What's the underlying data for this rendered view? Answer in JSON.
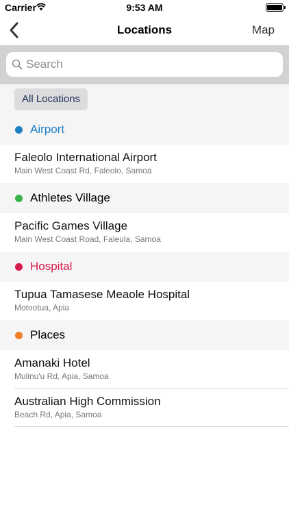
{
  "status_bar": {
    "carrier": "Carrier",
    "time": "9:53 AM"
  },
  "nav": {
    "title": "Locations",
    "map_label": "Map"
  },
  "search": {
    "placeholder": "Search",
    "value": ""
  },
  "filter": {
    "chip_label": "All Locations"
  },
  "sections": [
    {
      "title": "Airport",
      "color": "#1d7fc4",
      "items": [
        {
          "title": "Faleolo International Airport",
          "subtitle": "Main West Coast Rd, Faleolo, Samoa"
        }
      ]
    },
    {
      "title": "Athletes Village",
      "color": "#3bb14b",
      "items": [
        {
          "title": "Pacific Games Village",
          "subtitle": "Main West Coast Road, Faleula, Samoa"
        }
      ]
    },
    {
      "title": "Hospital",
      "color": "#d81b4a",
      "items": [
        {
          "title": "Tupua Tamasese Meaole Hospital",
          "subtitle": "Motootua, Apia"
        }
      ]
    },
    {
      "title": "Places",
      "color": "#f07d28",
      "items": [
        {
          "title": "Amanaki Hotel",
          "subtitle": "Mulinu'u Rd, Apia, Samoa"
        },
        {
          "title": "Australian High Commission",
          "subtitle": "Beach Rd, Apia, Samoa"
        }
      ]
    }
  ]
}
